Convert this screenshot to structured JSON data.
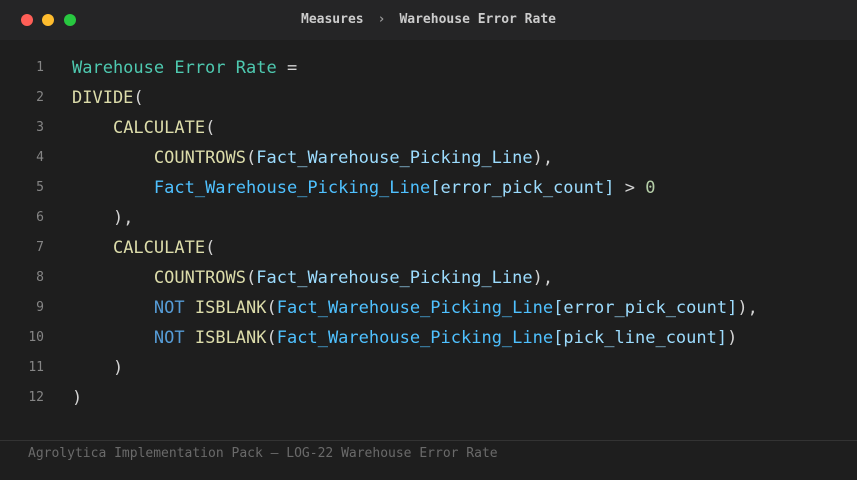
{
  "window": {
    "controls": [
      "close",
      "minimize",
      "maximize"
    ],
    "breadcrumb": {
      "parent": "Measures",
      "separator": "›",
      "current": "Warehouse Error Rate"
    }
  },
  "editor": {
    "lines": [
      {
        "number": "1",
        "tokens": [
          {
            "text": "Warehouse Error Rate",
            "kind": "measure"
          },
          {
            "text": " =",
            "kind": "op"
          }
        ]
      },
      {
        "number": "2",
        "tokens": [
          {
            "text": "DIVIDE",
            "kind": "fn"
          },
          {
            "text": "(",
            "kind": "op"
          }
        ]
      },
      {
        "number": "3",
        "tokens": [
          {
            "text": "    ",
            "kind": "op"
          },
          {
            "text": "CALCULATE",
            "kind": "fn"
          },
          {
            "text": "(",
            "kind": "op"
          }
        ]
      },
      {
        "number": "4",
        "tokens": [
          {
            "text": "        ",
            "kind": "op"
          },
          {
            "text": "COUNTROWS",
            "kind": "fn"
          },
          {
            "text": "(",
            "kind": "op"
          },
          {
            "text": "Fact_Warehouse_Picking_Line",
            "kind": "col"
          },
          {
            "text": "),",
            "kind": "op"
          }
        ]
      },
      {
        "number": "5",
        "tokens": [
          {
            "text": "        ",
            "kind": "op"
          },
          {
            "text": "Fact_Warehouse_Picking_Line",
            "kind": "tbl"
          },
          {
            "text": "[error_pick_count]",
            "kind": "col"
          },
          {
            "text": " > ",
            "kind": "op"
          },
          {
            "text": "0",
            "kind": "num"
          }
        ]
      },
      {
        "number": "6",
        "tokens": [
          {
            "text": "    ",
            "kind": "op"
          },
          {
            "text": "),",
            "kind": "op"
          }
        ]
      },
      {
        "number": "7",
        "tokens": [
          {
            "text": "    ",
            "kind": "op"
          },
          {
            "text": "CALCULATE",
            "kind": "fn"
          },
          {
            "text": "(",
            "kind": "op"
          }
        ]
      },
      {
        "number": "8",
        "tokens": [
          {
            "text": "        ",
            "kind": "op"
          },
          {
            "text": "COUNTROWS",
            "kind": "fn"
          },
          {
            "text": "(",
            "kind": "op"
          },
          {
            "text": "Fact_Warehouse_Picking_Line",
            "kind": "col"
          },
          {
            "text": "),",
            "kind": "op"
          }
        ]
      },
      {
        "number": "9",
        "tokens": [
          {
            "text": "        ",
            "kind": "op"
          },
          {
            "text": "NOT",
            "kind": "kw"
          },
          {
            "text": " ",
            "kind": "op"
          },
          {
            "text": "ISBLANK",
            "kind": "fn"
          },
          {
            "text": "(",
            "kind": "op"
          },
          {
            "text": "Fact_Warehouse_Picking_Line",
            "kind": "tbl"
          },
          {
            "text": "[error_pick_count]",
            "kind": "col"
          },
          {
            "text": "),",
            "kind": "op"
          }
        ]
      },
      {
        "number": "10",
        "tokens": [
          {
            "text": "        ",
            "kind": "op"
          },
          {
            "text": "NOT",
            "kind": "kw"
          },
          {
            "text": " ",
            "kind": "op"
          },
          {
            "text": "ISBLANK",
            "kind": "fn"
          },
          {
            "text": "(",
            "kind": "op"
          },
          {
            "text": "Fact_Warehouse_Picking_Line",
            "kind": "tbl"
          },
          {
            "text": "[pick_line_count]",
            "kind": "col"
          },
          {
            "text": ")",
            "kind": "op"
          }
        ]
      },
      {
        "number": "11",
        "tokens": [
          {
            "text": "    ",
            "kind": "op"
          },
          {
            "text": ")",
            "kind": "op"
          }
        ]
      },
      {
        "number": "12",
        "tokens": [
          {
            "text": ")",
            "kind": "op"
          }
        ]
      }
    ]
  },
  "footer": {
    "text": "Agrolytica Implementation Pack — LOG-22 Warehouse Error Rate"
  },
  "colors": {
    "background": "#1e1e1e",
    "titlebar": "#252526",
    "measure": "#4ec9b0",
    "function": "#dcdcaa",
    "table": "#4fc1ff",
    "keyword": "#569cd6",
    "column": "#9cdcfe",
    "number": "#b5cea8"
  }
}
